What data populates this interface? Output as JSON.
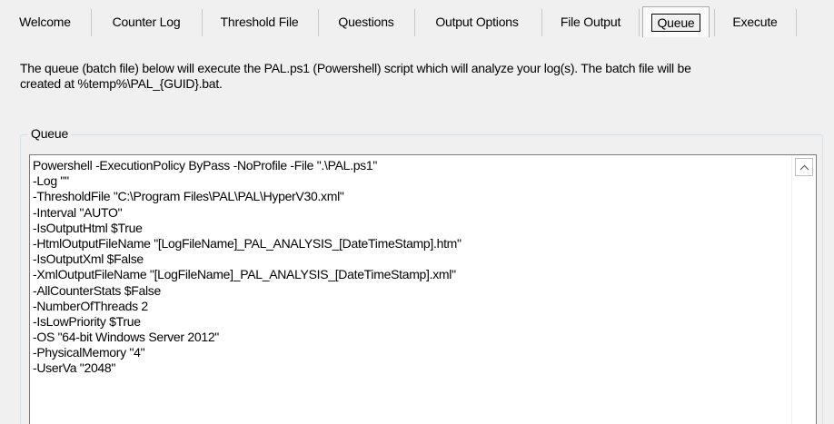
{
  "tabs": [
    {
      "label": "Welcome",
      "selected": false
    },
    {
      "label": "Counter Log",
      "selected": false
    },
    {
      "label": "Threshold File",
      "selected": false
    },
    {
      "label": "Questions",
      "selected": false
    },
    {
      "label": "Output Options",
      "selected": false
    },
    {
      "label": "File Output",
      "selected": false
    },
    {
      "label": "Queue",
      "selected": true
    },
    {
      "label": "Execute",
      "selected": false
    }
  ],
  "description": {
    "line1": "The queue (batch file) below will execute the PAL.ps1 (Powershell) script which will analyze your log(s). The batch file will be",
    "line2": "created at %temp%\\PAL_{GUID}.bat."
  },
  "queue": {
    "group_label": "Queue",
    "lines": [
      "Powershell -ExecutionPolicy ByPass -NoProfile -File \".\\PAL.ps1\"",
      "-Log \"\"",
      "-ThresholdFile \"C:\\Program Files\\PAL\\PAL\\HyperV30.xml\"",
      "-Interval \"AUTO\"",
      "-IsOutputHtml $True",
      "-HtmlOutputFileName \"[LogFileName]_PAL_ANALYSIS_[DateTimeStamp].htm\"",
      "-IsOutputXml $False",
      "-XmlOutputFileName \"[LogFileName]_PAL_ANALYSIS_[DateTimeStamp].xml\"",
      "-AllCounterStats $False",
      "-NumberOfThreads 2",
      "-IsLowPriority $True",
      "-OS \"64-bit Windows Server 2012\"",
      "-PhysicalMemory \"4\"",
      "-UserVa \"2048\""
    ]
  },
  "icons": {
    "scroll_up": "chevron-up-icon"
  }
}
